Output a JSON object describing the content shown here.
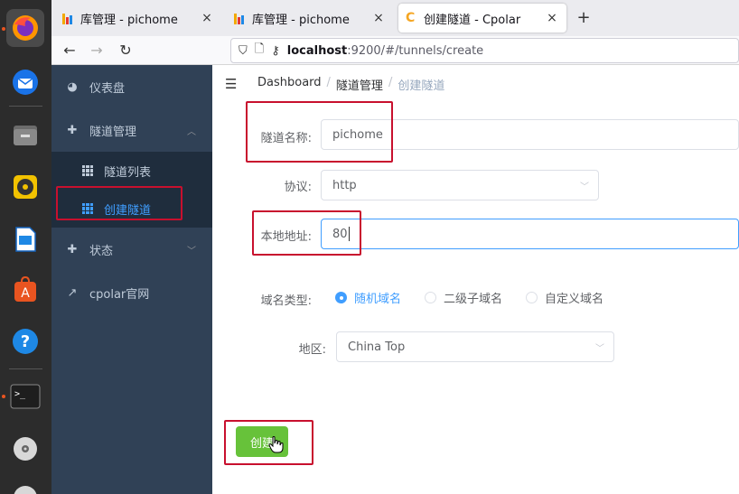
{
  "browser": {
    "tabs": [
      {
        "title": "库管理 - pichome",
        "close": "×"
      },
      {
        "title": "库管理 - pichome",
        "close": "×"
      },
      {
        "title": "创建隧道 - Cpolar",
        "close": "×"
      }
    ],
    "new_tab": "+",
    "url_host": "localhost",
    "url_rest": ":9200/#/tunnels/create"
  },
  "sidebar": {
    "items": [
      {
        "label": "仪表盘"
      },
      {
        "label": "隧道管理"
      },
      {
        "label": "状态"
      },
      {
        "label": "cpolar官网"
      }
    ],
    "sub_items": [
      {
        "label": "隧道列表"
      },
      {
        "label": "创建隧道"
      }
    ]
  },
  "breadcrumb": {
    "home": "Dashboard",
    "sep": "/",
    "parent": "隧道管理",
    "current": "创建隧道"
  },
  "form": {
    "name_label": "隧道名称:",
    "name_value": "pichome",
    "protocol_label": "协议:",
    "protocol_value": "http",
    "local_label": "本地地址:",
    "local_value": "80",
    "domain_type_label": "域名类型:",
    "domain_options": [
      "随机域名",
      "二级子域名",
      "自定义域名"
    ],
    "region_label": "地区:",
    "region_value": "China Top",
    "create_button": "创建"
  },
  "colors": {
    "sidebar_bg": "#304156",
    "accent": "#409eff",
    "create_button": "#67c23a",
    "highlight_box": "#c8102e"
  }
}
